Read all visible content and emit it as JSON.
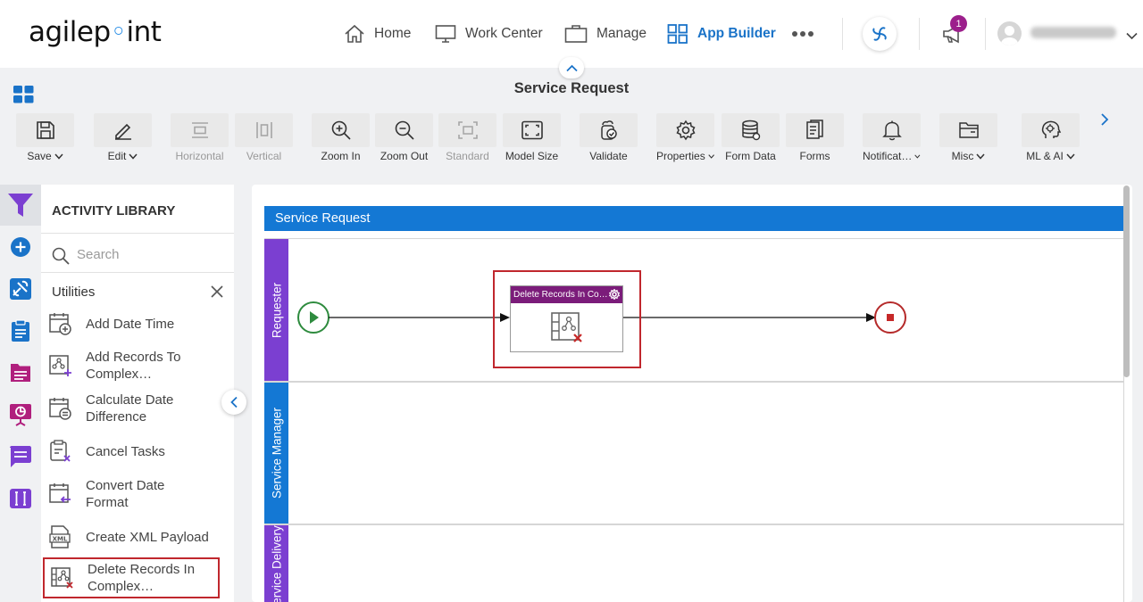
{
  "nav": {
    "logo_text": "agilep",
    "logo_rest": "int",
    "home": "Home",
    "work_center": "Work Center",
    "manage": "Manage",
    "app_builder": "App Builder",
    "notification_count": "1",
    "accent": "#1a73c8"
  },
  "page": {
    "title": "Service Request"
  },
  "toolbar": {
    "save": "Save",
    "edit": "Edit",
    "horizontal": "Horizontal",
    "vertical": "Vertical",
    "zoom_in": "Zoom In",
    "zoom_out": "Zoom Out",
    "standard": "Standard",
    "model_size": "Model Size",
    "validate": "Validate",
    "properties": "Properties",
    "form_data": "Form Data",
    "forms": "Forms",
    "notifications": "Notificat…",
    "misc": "Misc",
    "ml_ai": "ML & AI"
  },
  "library": {
    "title": "ACTIVITY LIBRARY",
    "search_placeholder": "Search",
    "category": "Utilities",
    "items": [
      {
        "label": "Add Date Time"
      },
      {
        "label": "Add Records To Complex…"
      },
      {
        "label": "Calculate Date Difference"
      },
      {
        "label": "Cancel Tasks"
      },
      {
        "label": "Convert Date Format"
      },
      {
        "label": "Create XML Payload"
      },
      {
        "label": "Delete Records In Complex…"
      }
    ]
  },
  "canvas": {
    "pool_title": "Service Request",
    "lanes": [
      {
        "label": "Requester",
        "color": "#7b3fd1"
      },
      {
        "label": "Service Manager",
        "color": "#1478d4"
      },
      {
        "label": "Service Delivery",
        "color": "#7b3fd1"
      }
    ],
    "activity_title": "Delete Records In Co…",
    "highlight_color": "#c0272d"
  }
}
